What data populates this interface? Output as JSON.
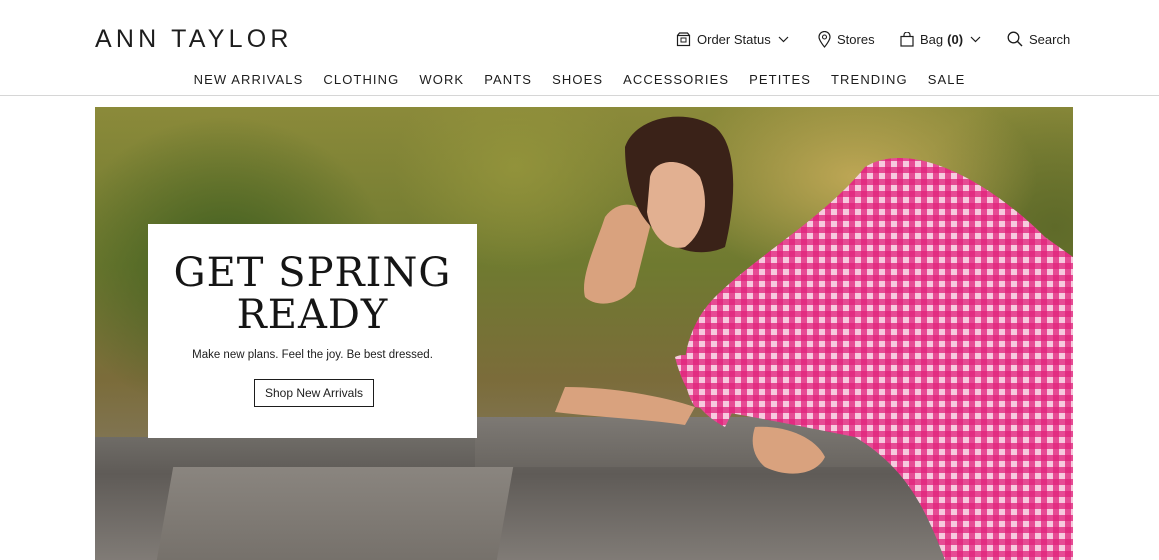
{
  "brand": {
    "logo_text": "ANN TAYLOR"
  },
  "utility_nav": {
    "order_status": {
      "label": "Order Status",
      "icon": "box-icon"
    },
    "stores": {
      "label": "Stores",
      "icon": "map-pin-icon"
    },
    "bag": {
      "label": "Bag",
      "count": "(0)",
      "icon": "shopping-bag-icon"
    },
    "search": {
      "label": "Search",
      "icon": "search-icon"
    }
  },
  "main_nav": {
    "items": [
      {
        "label": "NEW ARRIVALS"
      },
      {
        "label": "CLOTHING"
      },
      {
        "label": "WORK"
      },
      {
        "label": "PANTS"
      },
      {
        "label": "SHOES"
      },
      {
        "label": "ACCESSORIES"
      },
      {
        "label": "PETITES"
      },
      {
        "label": "TRENDING"
      },
      {
        "label": "SALE"
      }
    ]
  },
  "hero": {
    "title_line1": "GET SPRING",
    "title_line2": "READY",
    "subtitle": "Make new plans. Feel the joy. Be best dressed.",
    "cta_label": "Shop New Arrivals"
  },
  "colors": {
    "text": "#1d1d1d",
    "dress_pink": "#e0217a",
    "divider": "#d6d6d6"
  }
}
